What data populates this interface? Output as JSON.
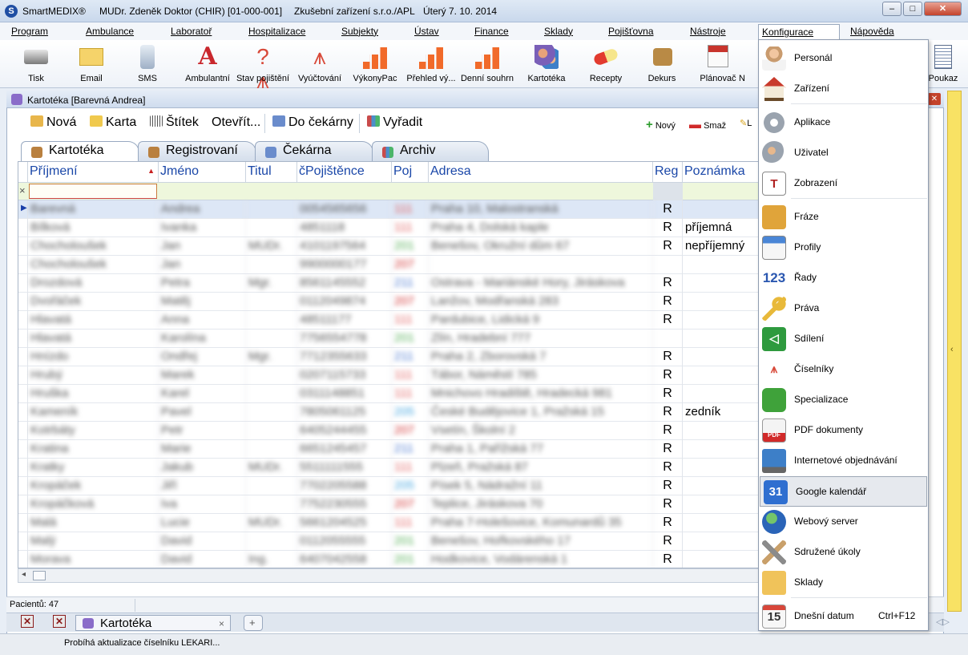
{
  "window": {
    "app_name": "SmartMEDIX®",
    "doctor": "MUDr. Zdeněk Doktor (CHIR) [01-000-001]",
    "facility": "Zkušební zařízení s.r.o./APL",
    "date": "Úterý 7. 10. 2014"
  },
  "menu": [
    "Program",
    "Ambulance",
    "Laboratoř",
    "Hospitalizace",
    "Subjekty",
    "Ústav",
    "Finance",
    "Sklady",
    "Pojišťovna",
    "Nástroje",
    "Konfigurace",
    "Nápověda"
  ],
  "ribbon": [
    "Tisk",
    "Email",
    "SMS",
    "Ambulantní",
    "Stav pojištění",
    "Vyúčtování",
    "VýkonyPac",
    "Přehled vý...",
    "Denní souhrn",
    "Kartotéka",
    "Recepty",
    "Dekurs",
    "Plánovač",
    "N",
    "Poukaz"
  ],
  "doc": {
    "title": "Kartotéka [Barevná Andrea]",
    "toolbar": {
      "nova": "Nová",
      "karta": "Karta",
      "stitek": "Štítek",
      "otevrit": "Otevřít...",
      "do_cekarny": "Do čekárny",
      "vyradit": "Vyřadit",
      "novy": "Nový",
      "smaz": "Smaž",
      "l": "L",
      "r": "r"
    },
    "tabs": [
      "Kartotéka",
      "Registrovaní",
      "Čekárna",
      "Archiv"
    ],
    "columns": [
      "Příjmení",
      "Jméno",
      "Titul",
      "čPojištěnce",
      "Poj",
      "Adresa",
      "Reg",
      "Poznámka"
    ],
    "filter_x": "×",
    "rows": [
      {
        "prijmeni": "Barevná",
        "jmeno": "Andrea",
        "titul": "",
        "cpoj": "0054565656",
        "poj": "111",
        "adresa": "Praha 10, Malostranská",
        "reg": "R",
        "pozn": ""
      },
      {
        "prijmeni": "Bílková",
        "jmeno": "Ivanka",
        "titul": "",
        "cpoj": "4851118",
        "poj": "111",
        "adresa": "Praha 4, Dolská kaple",
        "reg": "R",
        "pozn": "příjemná"
      },
      {
        "prijmeni": "Chocholoušek",
        "jmeno": "Jan",
        "titul": "MUDr.",
        "cpoj": "4101197564",
        "poj": "201",
        "adresa": "Benešov, Okružní dům 67",
        "reg": "R",
        "pozn": "nepříjemný"
      },
      {
        "prijmeni": "Chocholoušek",
        "jmeno": "Jan",
        "titul": "",
        "cpoj": "9900000177",
        "poj": "207",
        "adresa": "",
        "reg": "",
        "pozn": ""
      },
      {
        "prijmeni": "Drozdová",
        "jmeno": "Petra",
        "titul": "Mgr.",
        "cpoj": "8561145552",
        "poj": "211",
        "adresa": "Ostrava - Mariánské Hory, Jiráskova",
        "reg": "R",
        "pozn": ""
      },
      {
        "prijmeni": "Dvořáček",
        "jmeno": "Matěj",
        "titul": "",
        "cpoj": "0112049874",
        "poj": "207",
        "adresa": "Lanžov, Modřanská 283",
        "reg": "R",
        "pozn": ""
      },
      {
        "prijmeni": "Hlavatá",
        "jmeno": "Anna",
        "titul": "",
        "cpoj": "48511177",
        "poj": "111",
        "adresa": "Pardubice, Lidická 9",
        "reg": "R",
        "pozn": ""
      },
      {
        "prijmeni": "Hlavatá",
        "jmeno": "Karolína",
        "titul": "",
        "cpoj": "7756554778",
        "poj": "201",
        "adresa": "Zlín, Hradební 777",
        "reg": "",
        "pozn": ""
      },
      {
        "prijmeni": "Hnízdo",
        "jmeno": "Ondřej",
        "titul": "Mgr.",
        "cpoj": "7712355633",
        "poj": "211",
        "adresa": "Praha 2, Zborovská 7",
        "reg": "R",
        "pozn": ""
      },
      {
        "prijmeni": "Hrubý",
        "jmeno": "Marek",
        "titul": "",
        "cpoj": "0207115733",
        "poj": "111",
        "adresa": "Tábor, Náměstí 785",
        "reg": "R",
        "pozn": ""
      },
      {
        "prijmeni": "Hruška",
        "jmeno": "Karel",
        "titul": "",
        "cpoj": "0311148851",
        "poj": "111",
        "adresa": "Mnichovo Hradiště, Hradecká 981",
        "reg": "R",
        "pozn": ""
      },
      {
        "prijmeni": "Kameník",
        "jmeno": "Pavel",
        "titul": "",
        "cpoj": "7805061125",
        "poj": "205",
        "adresa": "České Budějovice 1, Pražská 15",
        "reg": "R",
        "pozn": "zedník"
      },
      {
        "prijmeni": "Kotrbáty",
        "jmeno": "Petr",
        "titul": "",
        "cpoj": "6405244455",
        "poj": "207",
        "adresa": "Vsetín, Školní 2",
        "reg": "R",
        "pozn": ""
      },
      {
        "prijmeni": "Kratina",
        "jmeno": "Marie",
        "titul": "",
        "cpoj": "6651245457",
        "poj": "211",
        "adresa": "Praha 1, Pařížská 77",
        "reg": "R",
        "pozn": ""
      },
      {
        "prijmeni": "Kratky",
        "jmeno": "Jakub",
        "titul": "MUDr.",
        "cpoj": "5511111555",
        "poj": "111",
        "adresa": "Plzeň, Pražská 87",
        "reg": "R",
        "pozn": ""
      },
      {
        "prijmeni": "Kropáček",
        "jmeno": "Jiří",
        "titul": "",
        "cpoj": "7702205588",
        "poj": "205",
        "adresa": "Písek 5, Nádražní 11",
        "reg": "R",
        "pozn": ""
      },
      {
        "prijmeni": "Kropáčková",
        "jmeno": "Iva",
        "titul": "",
        "cpoj": "7752230555",
        "poj": "207",
        "adresa": "Teplice, Jiráskova 70",
        "reg": "R",
        "pozn": ""
      },
      {
        "prijmeni": "Malá",
        "jmeno": "Lucie",
        "titul": "MUDr.",
        "cpoj": "5661204525",
        "poj": "111",
        "adresa": "Praha 7-Holešovice, Komunardů 35",
        "reg": "R",
        "pozn": ""
      },
      {
        "prijmeni": "Malý",
        "jmeno": "David",
        "titul": "",
        "cpoj": "0112055555",
        "poj": "201",
        "adresa": "Benešov, Hořkovského 17",
        "reg": "R",
        "pozn": ""
      },
      {
        "prijmeni": "Morava",
        "jmeno": "David",
        "titul": "Ing.",
        "cpoj": "6407042558",
        "poj": "201",
        "adresa": "Hodkovice, Vodárenská 1",
        "reg": "R",
        "pozn": ""
      }
    ],
    "poj_colors": {
      "111": "#e06060",
      "201": "#58b05a",
      "205": "#4aa8e0",
      "207": "#d23535",
      "211": "#4a78d0"
    },
    "patient_count": "Pacientů: 47",
    "bottom_tab": "Kartotéka",
    "status": "Probíhá aktualizace číselníku LEKARI..."
  },
  "dropdown": {
    "items": [
      {
        "label": "Personál",
        "icon": "personnel-icon"
      },
      {
        "label": "Zařízení",
        "icon": "house-icon"
      },
      {
        "label": "Aplikace",
        "icon": "gear-icon"
      },
      {
        "label": "Uživatel",
        "icon": "user-gear-icon"
      },
      {
        "label": "Zobrazení",
        "icon": "font-icon"
      },
      {
        "label": "Fráze",
        "icon": "star-folder-icon"
      },
      {
        "label": "Profily",
        "icon": "profile-card-icon"
      },
      {
        "label": "Řady",
        "icon": "numbers-icon"
      },
      {
        "label": "Práva",
        "icon": "key-icon"
      },
      {
        "label": "Sdílení",
        "icon": "share-icon"
      },
      {
        "label": "Číselníky",
        "icon": "codelist-icon"
      },
      {
        "label": "Specializace",
        "icon": "puzzle-icon"
      },
      {
        "label": "PDF dokumenty",
        "icon": "pdf-icon"
      },
      {
        "label": "Internetové objednávání",
        "icon": "monitor-icon"
      },
      {
        "label": "Google kalendář",
        "icon": "calendar-31-icon"
      },
      {
        "label": "Webový server",
        "icon": "globe-icon"
      },
      {
        "label": "Sdružené úkoly",
        "icon": "tools-icon"
      },
      {
        "label": "Sklady",
        "icon": "folder-icon"
      },
      {
        "label": "Dnešní datum",
        "icon": "calendar-15-icon",
        "shortcut": "Ctrl+F12"
      }
    ],
    "highlighted": "Google kalendář"
  }
}
